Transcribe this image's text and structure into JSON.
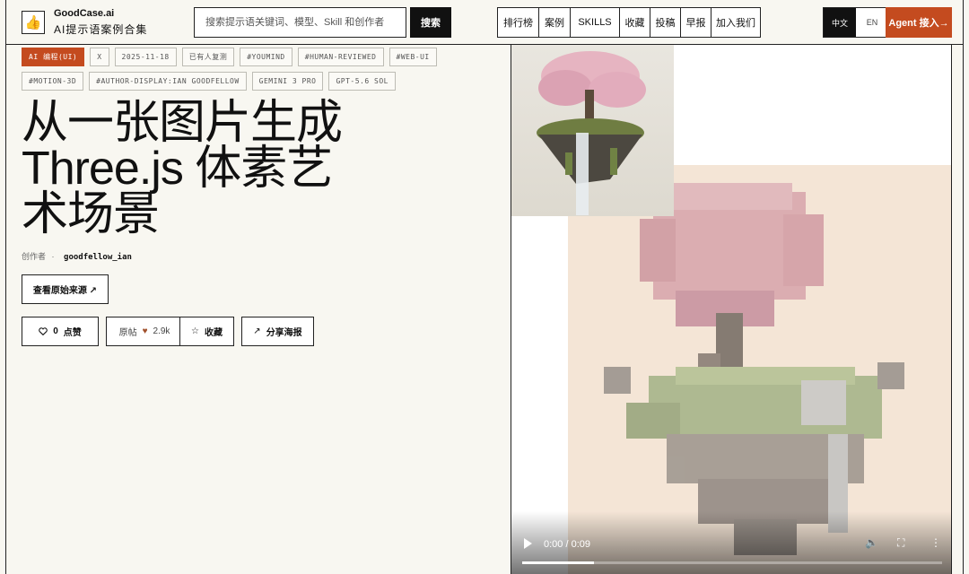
{
  "brand": {
    "name": "GoodCase.ai",
    "subtitle": "AI提示语案例合集",
    "logo_icon": "thumbs-up-icon"
  },
  "search": {
    "placeholder": "搜索提示语关键词、模型、Skill 和创作者",
    "button_label": "搜索"
  },
  "nav": {
    "items": [
      "排行榜",
      "案例",
      "SKILLS",
      "收藏",
      "投稿",
      "早报",
      "加入我们"
    ]
  },
  "lang": {
    "zh": "中文",
    "en": "EN"
  },
  "agent_button": "Agent 接入→",
  "tags": [
    "AI 编程(UI)",
    "X",
    "2025-11-18",
    "已有人复测",
    "#YOUMIND",
    "#HUMAN-REVIEWED",
    "#WEB-UI",
    "#MOTION-3D",
    "#AUTHOR-DISPLAY:IAN GOODFELLOW",
    "GEMINI 3 PRO",
    "GPT-5.6 SOL"
  ],
  "title": "从一张图片生成 Three.js 体素艺术场景",
  "author": {
    "label": "创作者",
    "separator": "·",
    "name": "goodfellow_ian"
  },
  "source_button": "查看原始来源 ↗",
  "actions": {
    "like": {
      "icon": "heart-outline-icon",
      "count": "0",
      "label": "点赞"
    },
    "original": {
      "label": "原帖",
      "icon": "heart-filled-icon",
      "count": "2.9k"
    },
    "favorite": {
      "icon": "star-icon",
      "label": "收藏"
    },
    "share": {
      "icon": "arrow-up-right-icon",
      "label": "分享海报"
    }
  },
  "video": {
    "time": "0:00 / 0:09",
    "progress": 0.17
  },
  "colors": {
    "accent": "#c44b1f",
    "background": "#f8f7f1",
    "ink": "#111111",
    "media_bg": "#f4e5d6"
  }
}
